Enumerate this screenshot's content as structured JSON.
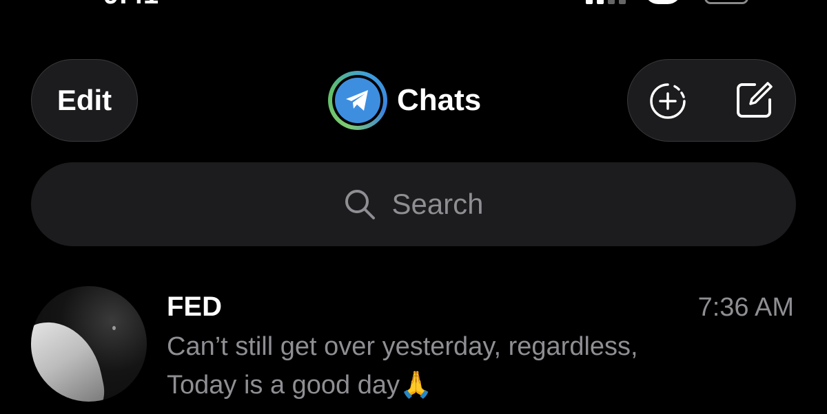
{
  "header": {
    "edit_label": "Edit",
    "title": "Chats"
  },
  "search": {
    "placeholder": "Search"
  },
  "chats": [
    {
      "name": "FED",
      "time": "7:36 AM",
      "preview_line1": "Can’t still get over yesterday, regardless,",
      "preview_line2": "Today is a good day🙏"
    }
  ],
  "icons": {
    "logo": "telegram-logo-icon",
    "new_story": "add-story-icon",
    "compose": "compose-icon",
    "search": "search-icon"
  },
  "colors": {
    "background": "#000000",
    "surface": "#1c1c1e",
    "secondary_text": "#8e8e93",
    "brand_blue": "#3e8ee0",
    "ring_green": "#6cc46d"
  }
}
